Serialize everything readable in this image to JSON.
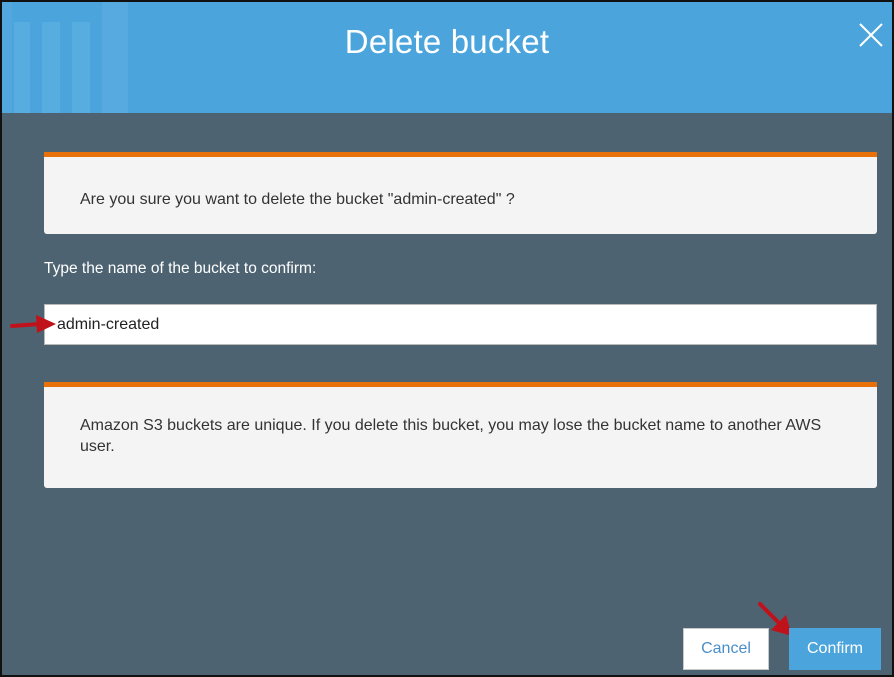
{
  "dialog": {
    "title": "Delete bucket",
    "close_icon": "close-icon"
  },
  "warning_notice": {
    "text": "Are you sure you want to delete the bucket \"admin-created\" ?"
  },
  "confirm_field": {
    "label": "Type the name of the bucket to confirm:",
    "value": "admin-created"
  },
  "info_notice": {
    "text": "Amazon S3 buckets are unique. If you delete this bucket, you may lose the bucket name to another AWS user."
  },
  "buttons": {
    "cancel_label": "Cancel",
    "confirm_label": "Confirm"
  },
  "colors": {
    "header": "#4ba5dc",
    "body": "#4d6372",
    "notice_accent": "#e8710a",
    "annotation_arrow": "#c0121b"
  },
  "annotations": {
    "arrow_icon": "red-arrow-icon"
  }
}
